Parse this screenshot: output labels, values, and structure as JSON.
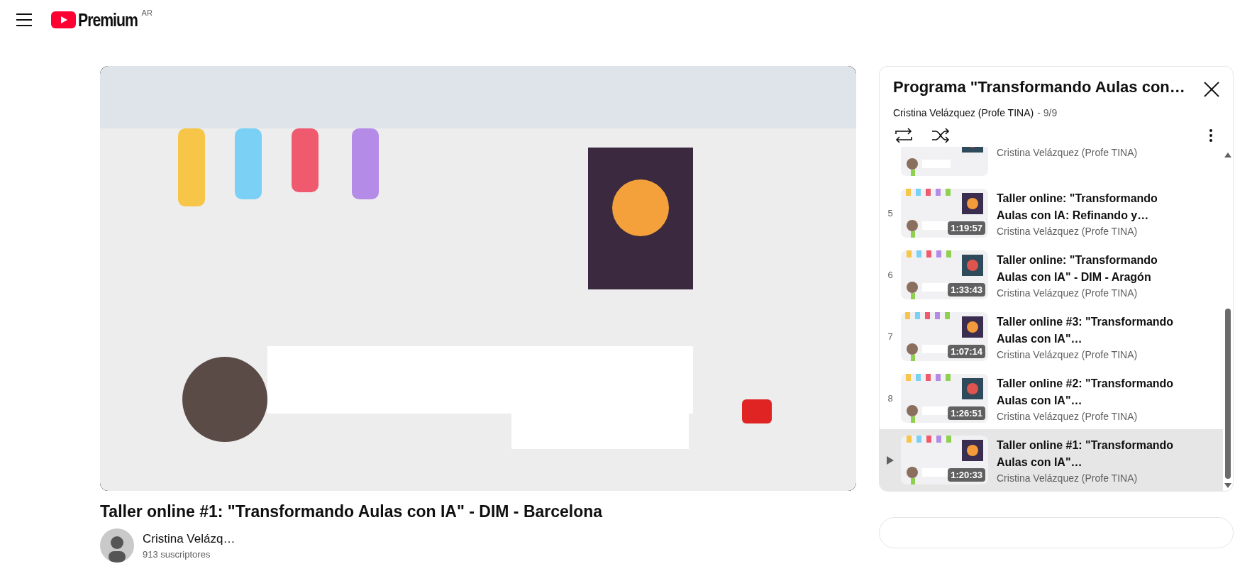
{
  "header": {
    "logo_text": "Premium",
    "region": "AR"
  },
  "video": {
    "kind": "picture",
    "title": "Taller online #1: \"Transformando Aulas con IA\" - DIM - Barcelona",
    "channel": {
      "name": "Cristina Velázq…",
      "subscribers": "913 suscriptores"
    }
  },
  "playlist": {
    "title": "Programa \"Transformando Aulas con…",
    "owner": "Cristina Velázquez (Profe TINA)",
    "position": "- 9/9",
    "items": [
      {
        "channel": "Cristina Velázquez (Profe TINA)",
        "selected": false
      },
      {
        "number": "5",
        "title": "Taller online: \"Transformando Aulas con IA: Refinando y…",
        "duration": "1:19:57",
        "channel": "Cristina Velázquez (Profe TINA)",
        "selected": false
      },
      {
        "number": "6",
        "title": "Taller online: \"Transformando Aulas con IA\" - DIM - Aragón",
        "duration": "1:33:43",
        "channel": "Cristina Velázquez (Profe TINA)",
        "selected": false
      },
      {
        "number": "7",
        "title": "Taller online #3: \"Transformando Aulas con IA\"…",
        "duration": "1:07:14",
        "channel": "Cristina Velázquez (Profe TINA)",
        "selected": false
      },
      {
        "number": "8",
        "title": "Taller online #2: \"Transformando Aulas con IA\"…",
        "duration": "1:26:51",
        "channel": "Cristina Velázquez (Profe TINA)",
        "selected": false
      },
      {
        "title": "Taller online #1: \"Transformando Aulas con IA\"…",
        "duration": "1:20:33",
        "channel": "Cristina Velázquez (Profe TINA)",
        "selected": true
      }
    ]
  }
}
